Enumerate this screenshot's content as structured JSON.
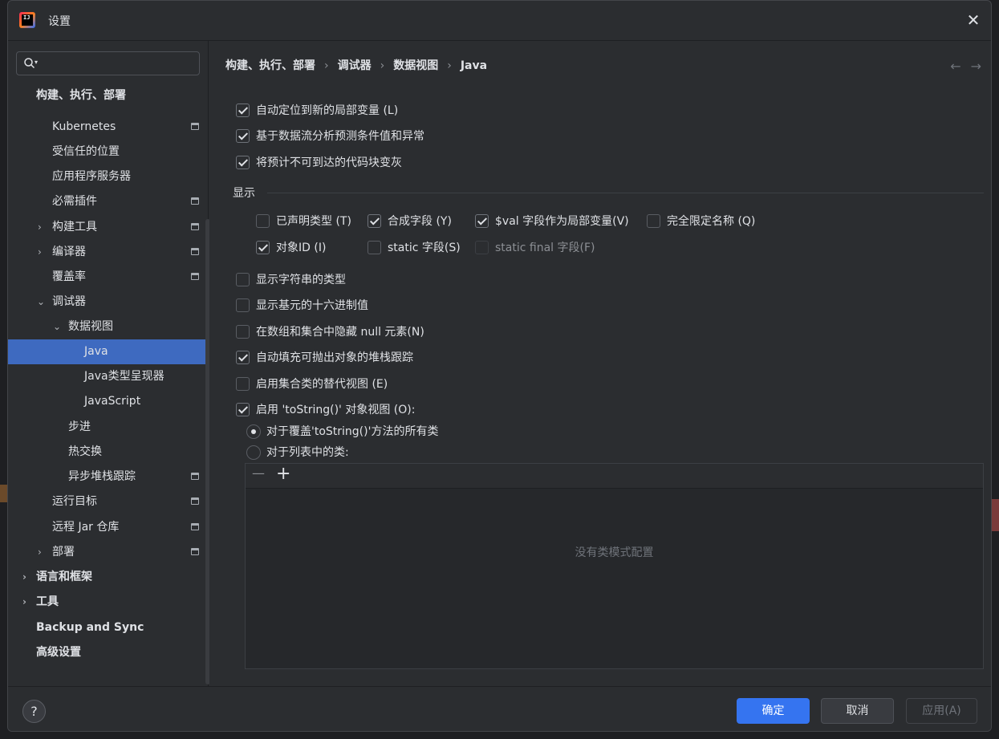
{
  "window": {
    "title": "设置"
  },
  "search": {
    "placeholder": ""
  },
  "sidebar": {
    "items": [
      {
        "label": "构建、执行、部署",
        "bold": true
      },
      {
        "label": "Kubernetes"
      },
      {
        "label": "受信任的位置"
      },
      {
        "label": "应用程序服务器"
      },
      {
        "label": "必需插件"
      },
      {
        "label": "构建工具"
      },
      {
        "label": "编译器"
      },
      {
        "label": "覆盖率"
      },
      {
        "label": "调试器"
      },
      {
        "label": "数据视图"
      },
      {
        "label": "Java",
        "selected": true
      },
      {
        "label": "Java类型呈现器"
      },
      {
        "label": "JavaScript"
      },
      {
        "label": "步进"
      },
      {
        "label": "热交换"
      },
      {
        "label": "异步堆栈跟踪"
      },
      {
        "label": "运行目标"
      },
      {
        "label": "远程 Jar 仓库"
      },
      {
        "label": "部署"
      },
      {
        "label": "语言和框架",
        "bold": true
      },
      {
        "label": "工具",
        "bold": true
      },
      {
        "label": "Backup and Sync",
        "bold": true
      },
      {
        "label": "高级设置",
        "bold": true
      }
    ]
  },
  "breadcrumb": [
    "构建、执行、部署",
    "调试器",
    "数据视图",
    "Java"
  ],
  "nav": {
    "back": "←",
    "forward": "→"
  },
  "options": {
    "auto_locate": {
      "label": "自动定位到新的局部变量 (L)",
      "checked": true
    },
    "predict": {
      "label": "基于数据流分析预测条件值和异常",
      "checked": true
    },
    "gray_unreachable": {
      "label": "将预计不可到达的代码块变灰",
      "checked": true
    },
    "display_section": "显示",
    "declared_type": {
      "label": "已声明类型 (T)",
      "checked": false
    },
    "synthetic": {
      "label": "合成字段 (Y)",
      "checked": true
    },
    "val_fields": {
      "label": "$val 字段作为局部变量(V)",
      "checked": true
    },
    "fqn": {
      "label": "完全限定名称 (Q)",
      "checked": false
    },
    "object_id": {
      "label": "对象ID (I)",
      "checked": true
    },
    "static_field": {
      "label": "static 字段(S)",
      "checked": false
    },
    "static_final": {
      "label": "static final 字段(F)",
      "checked": false,
      "disabled": true
    },
    "string_type": {
      "label": "显示字符串的类型",
      "checked": false
    },
    "hex": {
      "label": "显示基元的十六进制值",
      "checked": false
    },
    "hide_null": {
      "label": "在数组和集合中隐藏 null 元素(N)",
      "checked": false
    },
    "stacktrace": {
      "label": "自动填充可抛出对象的堆栈跟踪",
      "checked": true
    },
    "alt_view": {
      "label": "启用集合类的替代视图 (E)",
      "checked": false
    },
    "tostring": {
      "label": "启用 'toString()' 对象视图 (O):",
      "checked": true
    },
    "radio_all": {
      "label": "对于覆盖'toString()'方法的所有类",
      "checked": true
    },
    "radio_list": {
      "label": "对于列表中的类:",
      "checked": false
    }
  },
  "list": {
    "remove": "—",
    "add": "+",
    "empty": "没有类模式配置"
  },
  "buttons": {
    "ok": "确定",
    "cancel": "取消",
    "apply": "应用(A)",
    "help": "?"
  },
  "colors": {
    "accent": "#3574f0",
    "selected": "#3e6ac0",
    "background": "#2b2d30"
  }
}
